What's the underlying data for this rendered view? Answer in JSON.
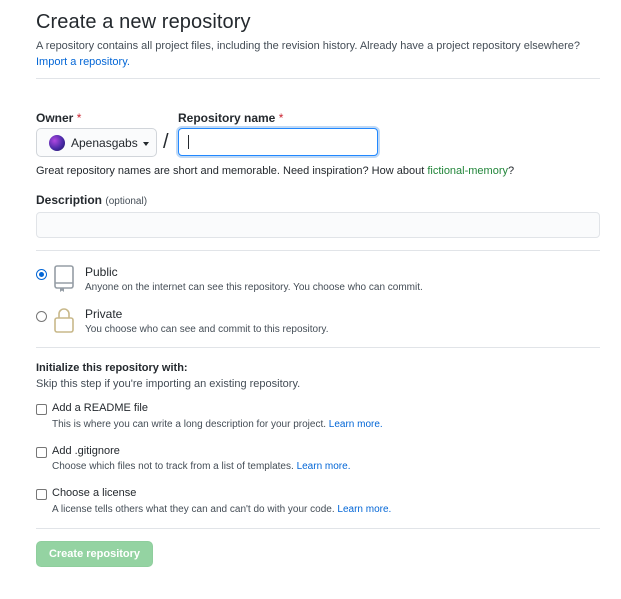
{
  "header": {
    "title": "Create a new repository",
    "subtitle_text": "A repository contains all project files, including the revision history. Already have a project repository elsewhere?",
    "import_link": "Import a repository."
  },
  "owner": {
    "label": "Owner",
    "required_mark": "*",
    "selected": "Apenasgabs"
  },
  "repo": {
    "label": "Repository name",
    "required_mark": "*",
    "value": "",
    "separator": "/"
  },
  "name_note": {
    "prefix": "Great repository names are short and memorable. Need inspiration? How about ",
    "suggestion": "fictional-memory",
    "suffix": "?"
  },
  "description": {
    "label": "Description",
    "optional": "(optional)",
    "value": ""
  },
  "visibility": {
    "selected": "public",
    "public_title": "Public",
    "public_desc": "Anyone on the internet can see this repository. You choose who can commit.",
    "private_title": "Private",
    "private_desc": "You choose who can see and commit to this repository."
  },
  "init": {
    "title": "Initialize this repository with:",
    "subtitle": "Skip this step if you're importing an existing repository.",
    "options": [
      {
        "title": "Add a README file",
        "desc": "This is where you can write a long description for your project.",
        "link": "Learn more.",
        "checked": false
      },
      {
        "title": "Add .gitignore",
        "desc": "Choose which files not to track from a list of templates.",
        "link": "Learn more.",
        "checked": false
      },
      {
        "title": "Choose a license",
        "desc": "A license tells others what they can and can't do with your code.",
        "link": "Learn more.",
        "checked": false
      }
    ]
  },
  "create_button": "Create repository",
  "colors": {
    "accent": "#0366d6",
    "create_button_disabled": "#94d3a2",
    "required": "#cb2431"
  }
}
